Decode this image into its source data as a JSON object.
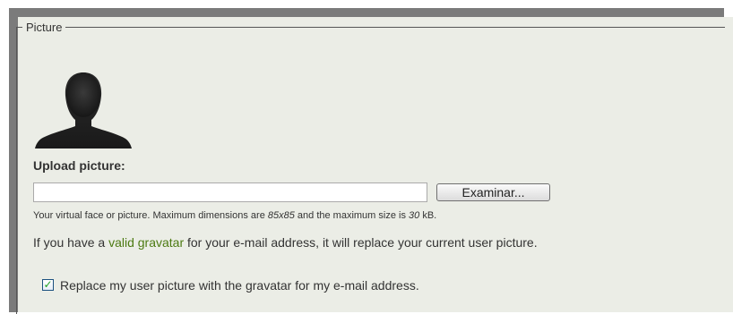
{
  "fieldset": {
    "legend": "Picture"
  },
  "avatar": {
    "icon": "default-user-silhouette-icon"
  },
  "upload": {
    "label": "Upload picture:",
    "value": "",
    "browse_label": "Examinar..."
  },
  "description": {
    "part1": "Your virtual face or picture. Maximum dimensions are ",
    "dimensions": "85x85",
    "part2": " and the maximum size is ",
    "size": "30",
    "part3": " kB."
  },
  "gravatar": {
    "prefix": "If you have a ",
    "link": "valid gravatar",
    "suffix": " for your e-mail address, it will replace your current user picture.",
    "link_color": "#4c7a12"
  },
  "checkbox": {
    "checked": true,
    "check_glyph": "✓",
    "label": "Replace my user picture with the gravatar for my e-mail address."
  }
}
